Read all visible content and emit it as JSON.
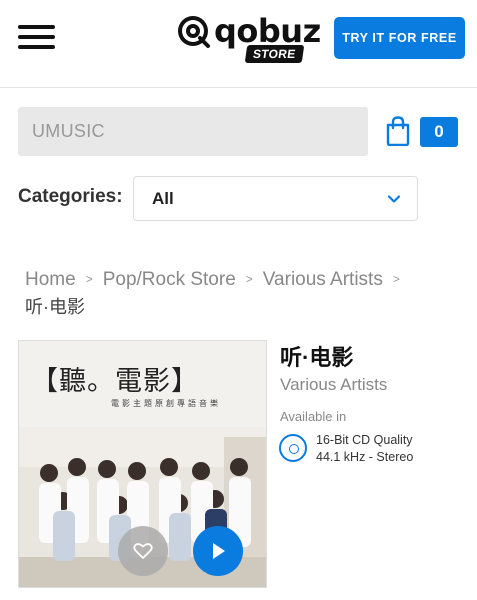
{
  "header": {
    "logo_text": "qobuz",
    "logo_badge": "STORE",
    "cta_label": "TRY IT FOR FREE"
  },
  "search": {
    "value": "UMUSIC"
  },
  "cart": {
    "count": "0"
  },
  "categories": {
    "label": "Categories:",
    "selected": "All"
  },
  "breadcrumb": {
    "home": "Home",
    "store": "Pop/Rock Store",
    "artist": "Various Artists",
    "separator": ">",
    "current": "听·电影"
  },
  "cover": {
    "title": "【聽。電影】",
    "subtitle": "電影主題原創專語音樂"
  },
  "album": {
    "title": "听·电影",
    "artist": "Various Artists",
    "available_label": "Available in",
    "quality_line1": "16-Bit CD Quality",
    "quality_line2": "44.1 kHz - Stereo"
  },
  "colors": {
    "accent": "#0a7ce0",
    "search_bg": "#e8e8e8"
  },
  "icons": {
    "menu": "hamburger-menu-icon",
    "cart": "shopping-bag-icon",
    "dropdown": "chevron-down-icon",
    "favorite": "heart-outline-icon",
    "play": "play-icon",
    "quality": "cd-disc-icon"
  }
}
